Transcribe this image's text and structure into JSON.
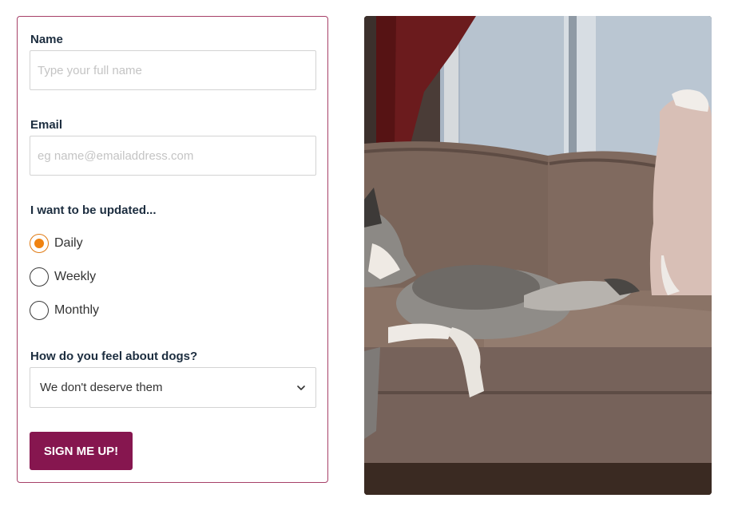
{
  "form": {
    "name_label": "Name",
    "name_placeholder": "Type your full name",
    "email_label": "Email",
    "email_placeholder": "eg name@emailaddress.com",
    "updates_label": "I want to be updated...",
    "update_options": [
      {
        "label": "Daily",
        "checked": true
      },
      {
        "label": "Weekly",
        "checked": false
      },
      {
        "label": "Monthly",
        "checked": false
      }
    ],
    "dogs_label": "How do you feel about dogs?",
    "dogs_selected": "We don't deserve them",
    "submit_label": "SIGN ME UP!"
  },
  "colors": {
    "accent": "#86164f",
    "card_border": "#a64068",
    "radio_selected": "#f0820f",
    "heading_text": "#1c2d3f"
  },
  "icons": {
    "select_chevron": "chevron-down-icon"
  }
}
